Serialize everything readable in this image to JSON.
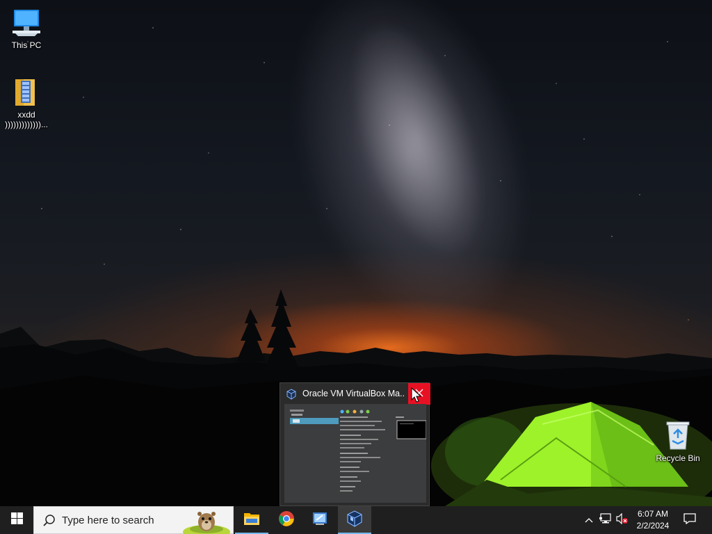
{
  "desktop": {
    "icons": [
      {
        "label": "This PC",
        "icon": "this-pc-icon"
      },
      {
        "label": "xxdd",
        "sublabel": ")))))))))))))...",
        "icon": "zip-folder-icon"
      },
      {
        "label": "Recycle Bin",
        "icon": "recycle-bin-icon"
      }
    ]
  },
  "preview": {
    "title": "Oracle VM VirtualBox Ma...",
    "icon": "virtualbox-icon",
    "close": "close-icon"
  },
  "taskbar": {
    "start": "windows-start-icon",
    "search_placeholder": "Type here to search",
    "apps": [
      {
        "name": "File Explorer",
        "icon": "file-explorer-icon"
      },
      {
        "name": "Google Chrome",
        "icon": "chrome-icon"
      },
      {
        "name": "Remote Desktop",
        "icon": "remote-desktop-icon"
      },
      {
        "name": "Oracle VM VirtualBox",
        "icon": "virtualbox-icon",
        "active": true
      }
    ],
    "tray": {
      "icons": [
        "chevron-up-icon",
        "network-icon",
        "volume-muted-icon"
      ],
      "time": "6:07 AM",
      "date": "2/2/2024",
      "notifications": "notification-icon"
    }
  },
  "colors": {
    "taskbar": "#1f1f1f",
    "accent": "#76b9ed",
    "close_red": "#e81123"
  }
}
